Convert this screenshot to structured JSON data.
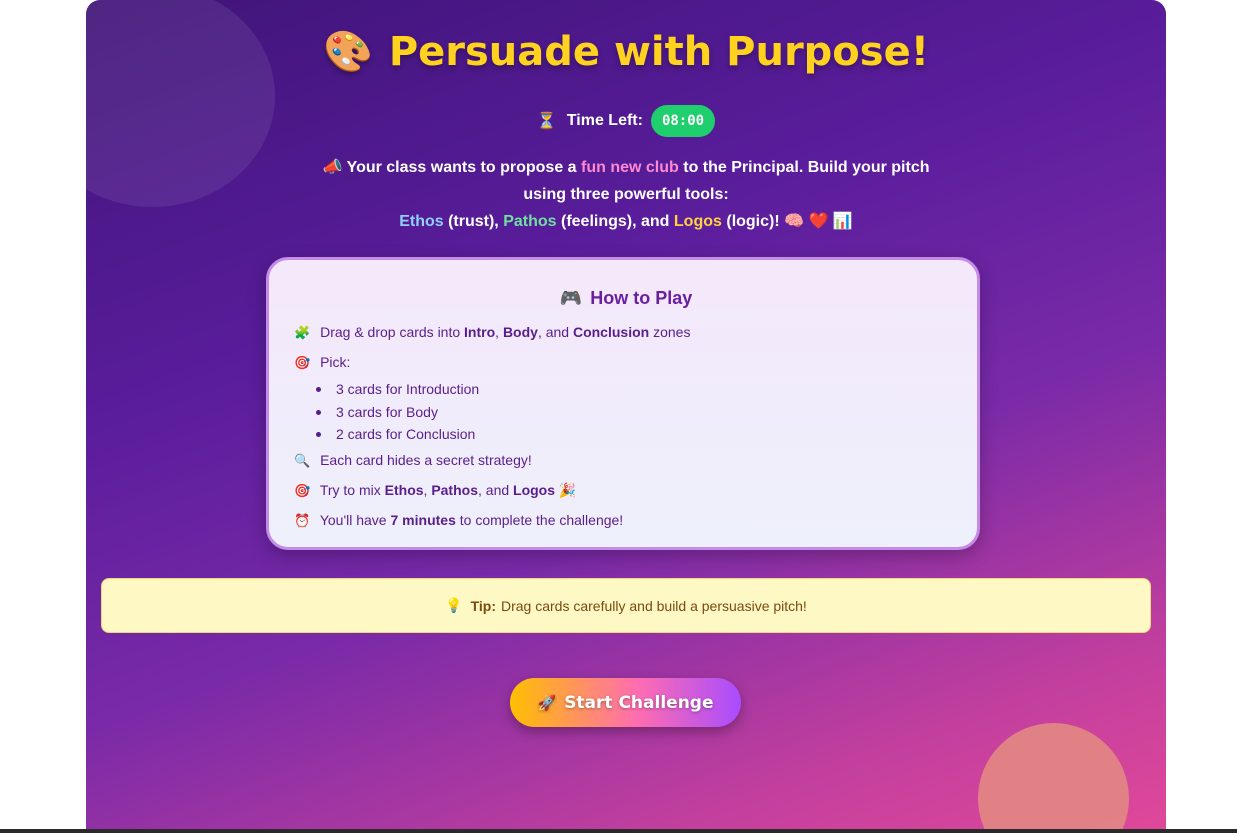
{
  "header": {
    "title_emoji": "🎨",
    "title": "Persuade with Purpose!",
    "timer_emoji": "⏳",
    "timer_label": "Time Left:",
    "timer_value": "08:00"
  },
  "intro": {
    "emoji": "📣",
    "part1": "Your class wants to propose a",
    "highlight": "fun new club",
    "part2": "to the Principal. Build your pitch using three powerful tools:",
    "ethos": "Ethos",
    "ethos_desc": "(trust),",
    "pathos": "Pathos",
    "pathos_desc": "(feelings), and",
    "logos": "Logos",
    "logos_desc": "(logic)!",
    "emojis": "🧠 ❤️ 📊"
  },
  "how_to_play": {
    "title_emoji": "🎮",
    "title": "How to Play",
    "line1": {
      "emoji": "🧩",
      "prefix": "Drag & drop cards into",
      "intro": "Intro",
      "sep1": ",",
      "body": "Body",
      "sep2": ", and",
      "conclusion": "Conclusion",
      "suffix": "zones"
    },
    "line2": {
      "emoji": "🎯",
      "text": "Pick:"
    },
    "bullets": [
      "3 cards for Introduction",
      "3 cards for Body",
      "2 cards for Conclusion"
    ],
    "line3": {
      "emoji": "🔍",
      "text": "Each card hides a secret strategy!"
    },
    "line4": {
      "emoji": "🎯",
      "prefix": "Try to mix",
      "ethos": "Ethos",
      "sep1": ",",
      "pathos": "Pathos",
      "sep2": ", and",
      "logos": "Logos",
      "suffix_emoji": "🎉"
    },
    "line5": {
      "emoji": "⏰",
      "prefix": "You'll have",
      "duration": "7 minutes",
      "suffix": "to complete the challenge!"
    }
  },
  "tip": {
    "emoji": "💡",
    "label": "Tip:",
    "text": "Drag cards carefully and build a persuasive pitch!"
  },
  "start_button": {
    "emoji": "🚀",
    "label": "Start Challenge"
  },
  "colors": {
    "title": "#ffd21f",
    "timer_badge": "#1fce6d",
    "tip_bg": "#fef8c4",
    "card_text": "#5a1e8c"
  }
}
